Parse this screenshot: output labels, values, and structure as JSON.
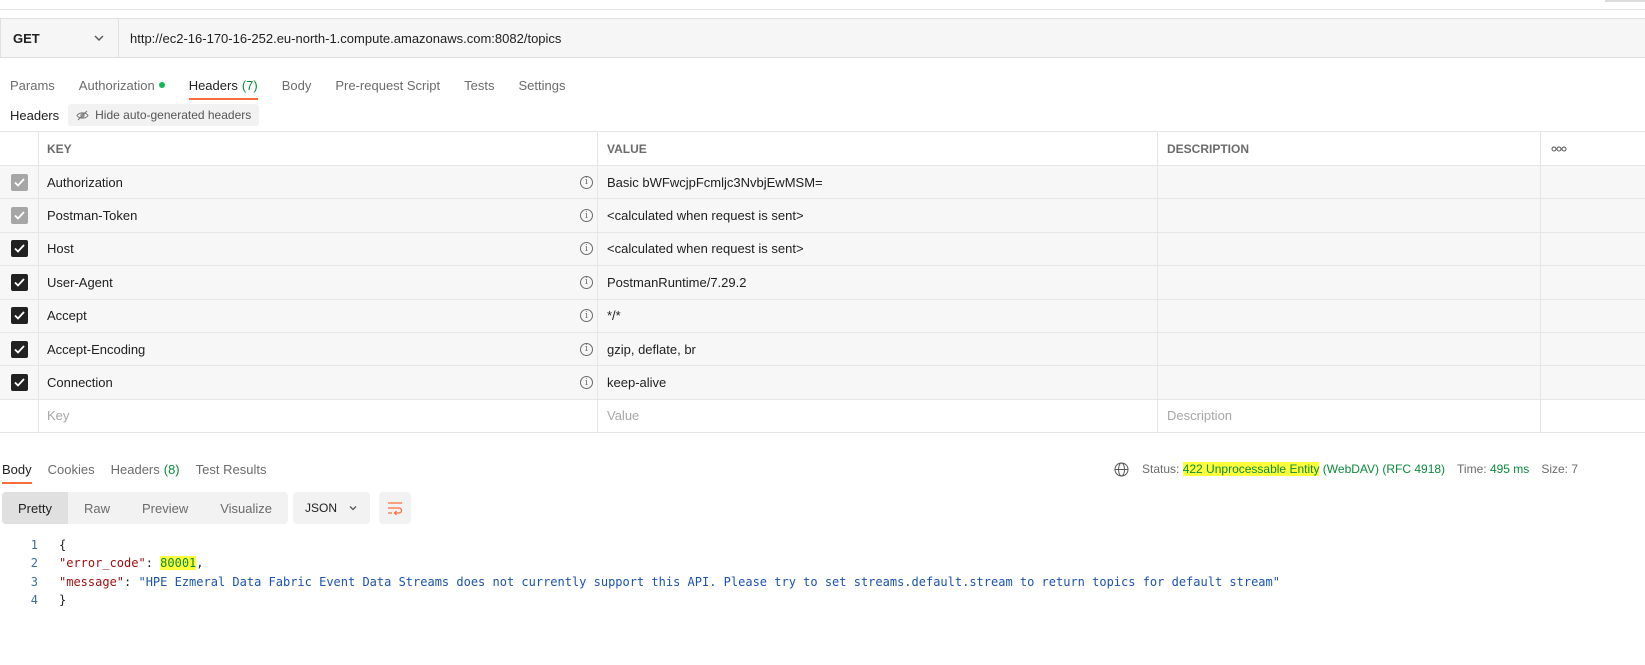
{
  "request": {
    "method": "GET",
    "url": "http://ec2-16-170-16-252.eu-north-1.compute.amazonaws.com:8082/topics"
  },
  "request_tabs": [
    {
      "label": "Params"
    },
    {
      "label": "Authorization"
    },
    {
      "label": "Headers",
      "count": "(7)"
    },
    {
      "label": "Body"
    },
    {
      "label": "Pre-request Script"
    },
    {
      "label": "Tests"
    },
    {
      "label": "Settings"
    }
  ],
  "headers_section": {
    "label": "Headers",
    "hide_button": "Hide auto-generated headers"
  },
  "table": {
    "columns": {
      "key": "KEY",
      "value": "VALUE",
      "description": "DESCRIPTION"
    },
    "rows": [
      {
        "key": "Authorization",
        "value": "Basic bWFwcjpFcmljc3NvbjEwMSM=",
        "checked": "disabled"
      },
      {
        "key": "Postman-Token",
        "value": "<calculated when request is sent>",
        "checked": "disabled"
      },
      {
        "key": "Host",
        "value": "<calculated when request is sent>",
        "checked": "on"
      },
      {
        "key": "User-Agent",
        "value": "PostmanRuntime/7.29.2",
        "checked": "on"
      },
      {
        "key": "Accept",
        "value": "*/*",
        "checked": "on"
      },
      {
        "key": "Accept-Encoding",
        "value": "gzip, deflate, br",
        "checked": "on"
      },
      {
        "key": "Connection",
        "value": "keep-alive",
        "checked": "on"
      }
    ],
    "new_row": {
      "key_placeholder": "Key",
      "value_placeholder": "Value",
      "description_placeholder": "Description"
    }
  },
  "response_tabs": [
    {
      "label": "Body"
    },
    {
      "label": "Cookies"
    },
    {
      "label": "Headers",
      "count": "(8)"
    },
    {
      "label": "Test Results"
    }
  ],
  "status": {
    "status_label": "Status:",
    "code_text": "422 Unprocessable Entity",
    "extra": "(WebDAV) (RFC 4918)",
    "time_label": "Time:",
    "time_value": "495 ms",
    "size_label": "Size: 7"
  },
  "view_buttons": [
    "Pretty",
    "Raw",
    "Preview",
    "Visualize"
  ],
  "format_select": "JSON",
  "response_body": {
    "line_numbers": [
      "1",
      "2",
      "3",
      "4"
    ],
    "open_brace": "{",
    "close_brace": "}",
    "error_code_key": "\"error_code\"",
    "error_code_value": "80001",
    "message_key": "\"message\"",
    "message_value": "\"HPE Ezmeral Data Fabric Event Data Streams does not currently support this API. Please try to set streams.default.stream to return topics for default stream\""
  },
  "colors": {
    "accent": "#ff6c37",
    "status_green": "#0a8a3a",
    "highlight": "#ffff3c"
  }
}
